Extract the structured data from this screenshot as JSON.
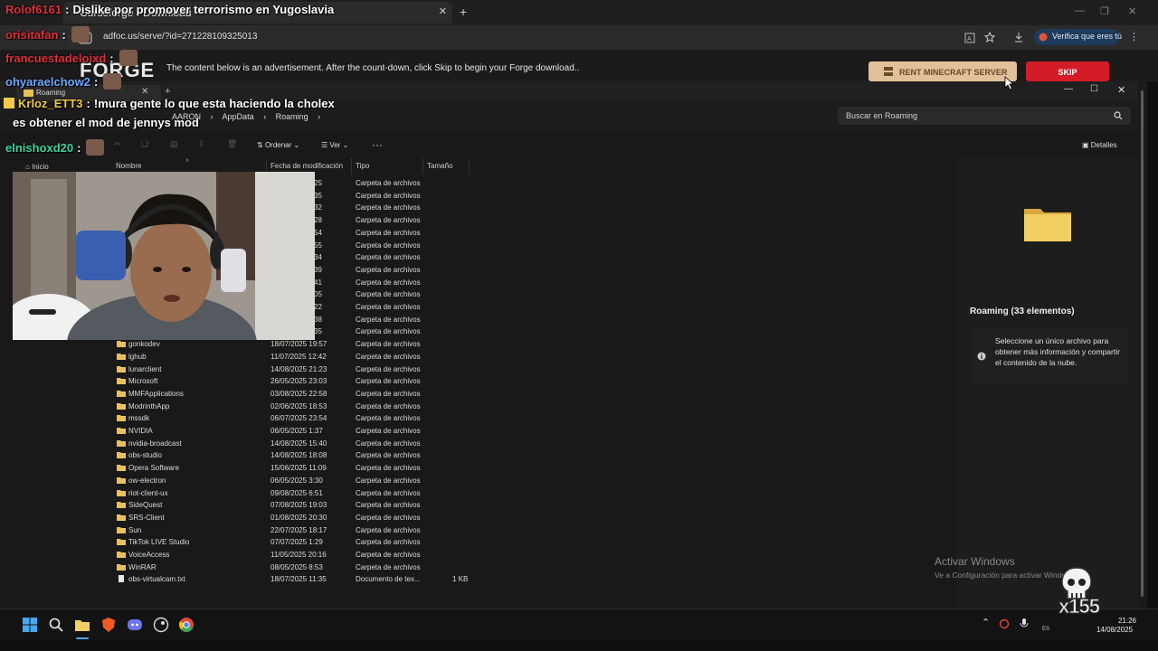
{
  "browser": {
    "tab_title": "Curseforge - Download",
    "url": "adfoc.us/serve/?id=271228109325013",
    "verify_label": "Verifica que eres tú"
  },
  "ad": {
    "logo": "FORGE",
    "message": "The content below is an advertisement. After the count-down, click Skip to begin your Forge download..",
    "rent_label": "RENT MINECRAFT SERVER",
    "skip_label": "SKIP"
  },
  "explorer": {
    "tab_title": "Roaming",
    "breadcrumb": [
      "AARON",
      "AppData",
      "Roaming",
      "›"
    ],
    "search_placeholder": "Buscar en Roaming",
    "toolbar": {
      "order_label": "Ordenar",
      "view_label": "Ver",
      "more_label": "···",
      "details_label": "Detalles"
    },
    "nav_home": "Inicio",
    "columns": {
      "name": "Nombre",
      "date": "Fecha de modificación",
      "type": "Tipo",
      "size": "Tamaño"
    },
    "hidden_rows": [
      {
        "date": "25",
        "type": "Carpeta de archivos"
      },
      {
        "date": "35",
        "type": "Carpeta de archivos"
      },
      {
        "date": "32",
        "type": "Carpeta de archivos"
      },
      {
        "date": "28",
        "type": "Carpeta de archivos"
      },
      {
        "date": "54",
        "type": "Carpeta de archivos"
      },
      {
        "date": "55",
        "type": "Carpeta de archivos"
      },
      {
        "date": "34",
        "type": "Carpeta de archivos"
      },
      {
        "date": "39",
        "type": "Carpeta de archivos"
      },
      {
        "date": "41",
        "type": "Carpeta de archivos"
      },
      {
        "date": "05",
        "type": "Carpeta de archivos"
      },
      {
        "date": "22",
        "type": "Carpeta de archivos"
      },
      {
        "date": "38",
        "type": "Carpeta de archivos"
      },
      {
        "date": "35",
        "type": "Carpeta de archivos"
      }
    ],
    "rows": [
      {
        "name": "gonkodev",
        "date": "18/07/2025 19:57",
        "type": "Carpeta de archivos",
        "size": "",
        "kind": "folder"
      },
      {
        "name": "lghub",
        "date": "11/07/2025 12:42",
        "type": "Carpeta de archivos",
        "size": "",
        "kind": "folder"
      },
      {
        "name": "lunarclient",
        "date": "14/08/2025 21:23",
        "type": "Carpeta de archivos",
        "size": "",
        "kind": "folder"
      },
      {
        "name": "Microsoft",
        "date": "26/05/2025 23:03",
        "type": "Carpeta de archivos",
        "size": "",
        "kind": "folder"
      },
      {
        "name": "MMFApplications",
        "date": "03/08/2025 22:58",
        "type": "Carpeta de archivos",
        "size": "",
        "kind": "folder"
      },
      {
        "name": "ModrinthApp",
        "date": "02/06/2025 18:53",
        "type": "Carpeta de archivos",
        "size": "",
        "kind": "folder"
      },
      {
        "name": "mssdk",
        "date": "06/07/2025 23:54",
        "type": "Carpeta de archivos",
        "size": "",
        "kind": "folder"
      },
      {
        "name": "NVIDIA",
        "date": "06/05/2025 1:37",
        "type": "Carpeta de archivos",
        "size": "",
        "kind": "folder"
      },
      {
        "name": "nvidia-broadcast",
        "date": "14/08/2025 15:40",
        "type": "Carpeta de archivos",
        "size": "",
        "kind": "folder"
      },
      {
        "name": "obs-studio",
        "date": "14/08/2025 18:08",
        "type": "Carpeta de archivos",
        "size": "",
        "kind": "folder"
      },
      {
        "name": "Opera Software",
        "date": "15/06/2025 11:09",
        "type": "Carpeta de archivos",
        "size": "",
        "kind": "folder"
      },
      {
        "name": "ow-electron",
        "date": "06/05/2025 3:30",
        "type": "Carpeta de archivos",
        "size": "",
        "kind": "folder"
      },
      {
        "name": "riot-client-ux",
        "date": "09/08/2025 6:51",
        "type": "Carpeta de archivos",
        "size": "",
        "kind": "folder"
      },
      {
        "name": "SideQuest",
        "date": "07/08/2025 19:03",
        "type": "Carpeta de archivos",
        "size": "",
        "kind": "folder"
      },
      {
        "name": "SRS-Client",
        "date": "01/08/2025 20:30",
        "type": "Carpeta de archivos",
        "size": "",
        "kind": "folder"
      },
      {
        "name": "Sun",
        "date": "22/07/2025 18:17",
        "type": "Carpeta de archivos",
        "size": "",
        "kind": "folder"
      },
      {
        "name": "TikTok LIVE Studio",
        "date": "07/07/2025 1:29",
        "type": "Carpeta de archivos",
        "size": "",
        "kind": "folder"
      },
      {
        "name": "VoiceAccess",
        "date": "11/05/2025 20:16",
        "type": "Carpeta de archivos",
        "size": "",
        "kind": "folder"
      },
      {
        "name": "WinRAR",
        "date": "08/05/2025 8:53",
        "type": "Carpeta de archivos",
        "size": "",
        "kind": "folder"
      },
      {
        "name": "obs-virtualcam.txt",
        "date": "18/07/2025 11:35",
        "type": "Documento de tex...",
        "size": "1 KB",
        "kind": "file"
      }
    ],
    "details": {
      "title": "Roaming (33 elementos)",
      "info": "Seleccione un único archivo para obtener más información y compartir el contenido de la nube."
    }
  },
  "windows": {
    "activate_title": "Activar Windows",
    "activate_sub": "Ve a Configuración para activar Windows."
  },
  "taskbar": {
    "time": "21:26",
    "date": "14/08/2025",
    "lang": "ES"
  },
  "chat": [
    {
      "user": "Rolof6161",
      "sep": ":",
      "msg": "Dislike por promover terrorismo en Yugoslavia",
      "color": "#e0303a"
    },
    {
      "user": "orisitafan",
      "sep": ":",
      "msg": "",
      "color": "#e0303a"
    },
    {
      "user": "francuestadeloixd",
      "sep": ":",
      "msg": "",
      "color": "#e0303a"
    },
    {
      "user": "ohyaraelchow2",
      "sep": ":",
      "msg": "",
      "color": "#6ea8ff"
    },
    {
      "user": "Krloz_ETT3",
      "sep": ":",
      "msg": "!mura gente lo que esta haciendo la cholex",
      "color": "#f2c94c"
    },
    {
      "user": "",
      "sep": "",
      "msg": "es obtener el mod de jennys mod",
      "color": "#ffffff"
    },
    {
      "user": "elnishoxd20",
      "sep": ":",
      "msg": "",
      "color": "#3ad6a0"
    }
  ],
  "watermark_text": "x155",
  "colors": {
    "accent": "#1d3b5b",
    "skip_red": "#d41c29",
    "rent_tan": "#e2c098",
    "folder_yellow": "#e8c15a"
  }
}
